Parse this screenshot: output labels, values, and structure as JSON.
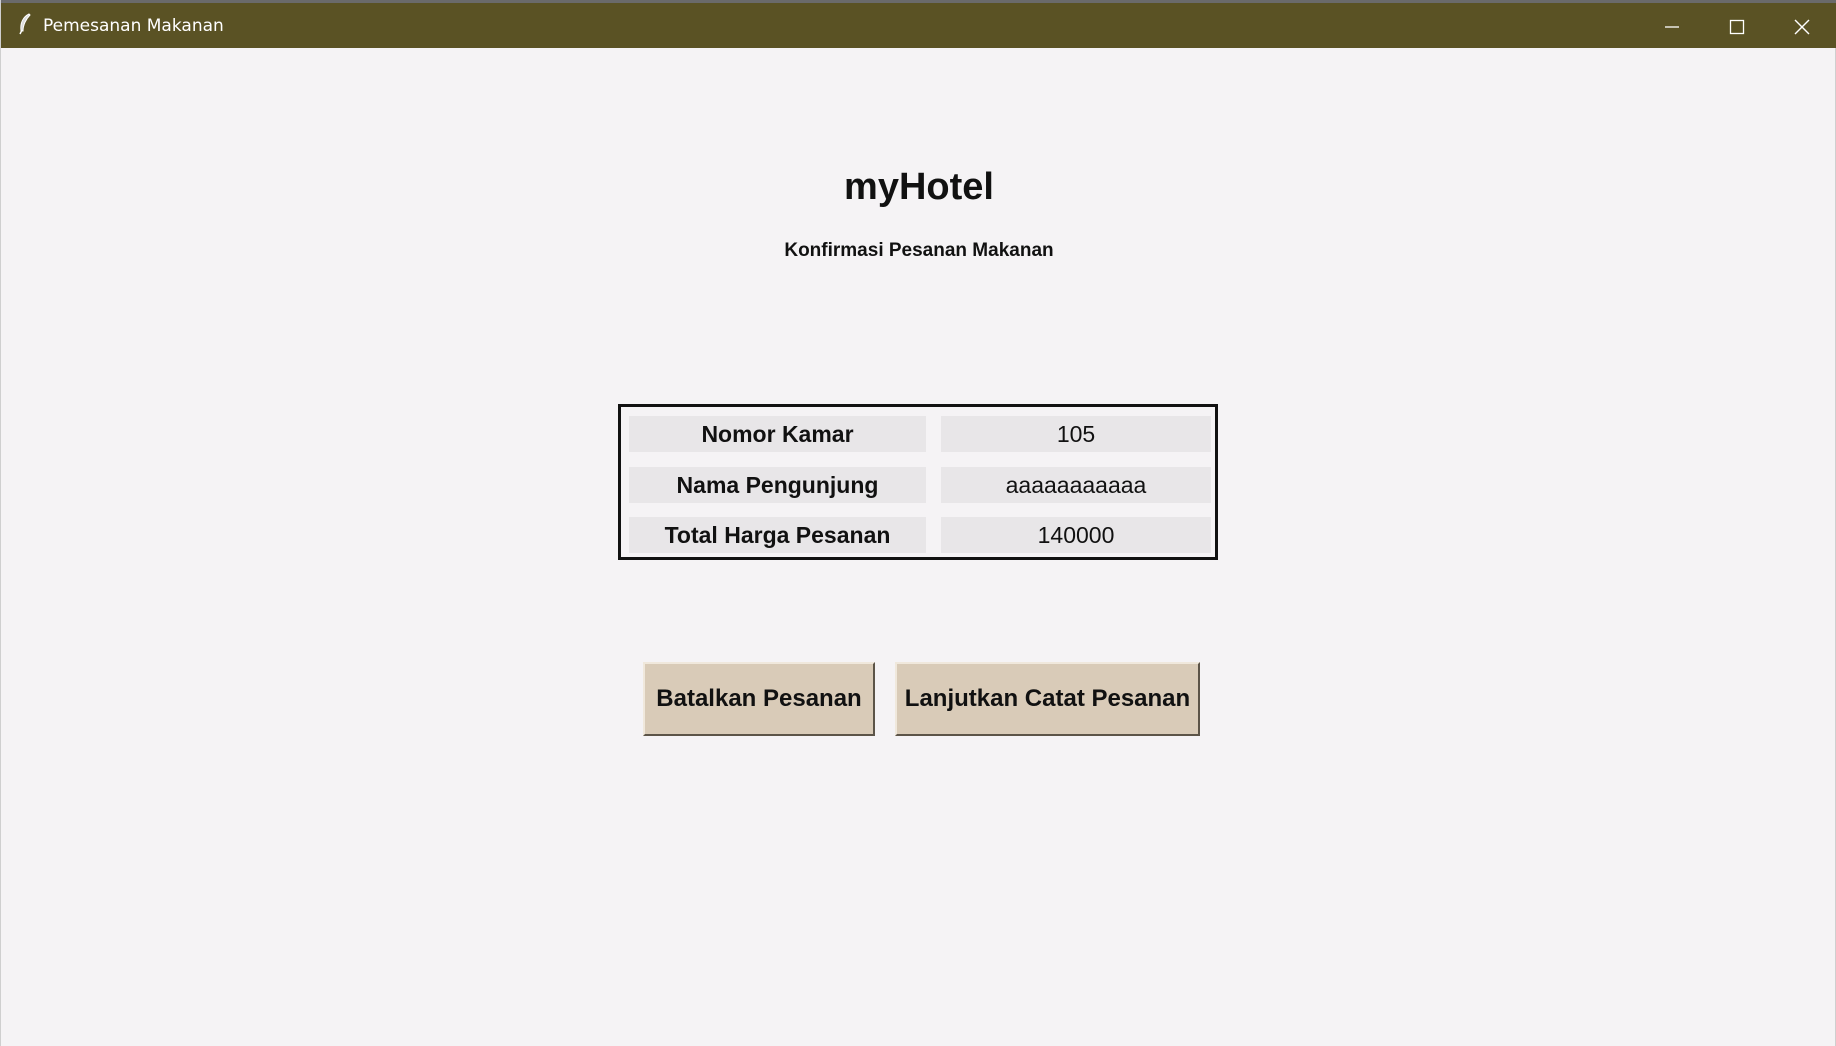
{
  "window": {
    "title": "Pemesanan Makanan",
    "icon": "feather-icon",
    "controls": [
      "minimize-icon",
      "maximize-icon",
      "close-icon"
    ]
  },
  "header": {
    "app_title": "myHotel",
    "subtitle": "Konfirmasi Pesanan Makanan"
  },
  "summary": {
    "rows": [
      {
        "label": "Nomor Kamar",
        "value": "105"
      },
      {
        "label": "Nama Pengunjung",
        "value": "aaaaaaaaaaa"
      },
      {
        "label": "Total Harga Pesanan",
        "value": "140000"
      }
    ]
  },
  "actions": {
    "cancel_label": "Batalkan Pesanan",
    "continue_label": "Lanjutkan Catat Pesanan"
  },
  "colors": {
    "titlebar": "#5a5224",
    "background": "#f5f3f5",
    "button": "#d9cbb8",
    "field": "#e8e6e8"
  }
}
